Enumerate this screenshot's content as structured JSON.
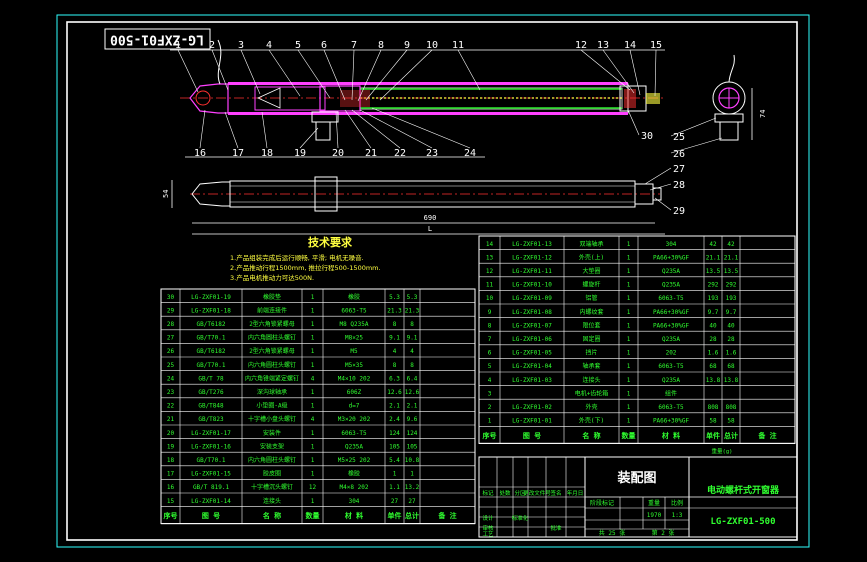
{
  "stamp": "LG-ZXF01-500",
  "balloons_top": [
    "1",
    "2",
    "3",
    "4",
    "5",
    "6",
    "7",
    "8",
    "9",
    "10",
    "11",
    "12",
    "13",
    "14",
    "15"
  ],
  "balloons_bottom": [
    "16",
    "17",
    "18",
    "19",
    "20",
    "21",
    "22",
    "23",
    "24"
  ],
  "balloons_right": [
    "30",
    "25",
    "26",
    "27",
    "28",
    "29"
  ],
  "dims": {
    "overall": "690",
    "length": "L",
    "height_side": "54",
    "height_end": "74"
  },
  "tech_title": "技术要求",
  "tech_notes": [
    "1.产品组装完成后运行顺畅, 平滑; 电机无噪音.",
    "2.产品推动行程1500mm, 推拉行程500-1500mm.",
    "3.产品电机推动力可达500N."
  ],
  "left_table": {
    "rows": [
      [
        "30",
        "LG-ZXF01-19",
        "橡胶垫",
        "1",
        "橡胶",
        "5.3",
        "5.3"
      ],
      [
        "29",
        "LG-ZXF01-18",
        "前端连接件",
        "1",
        "6063-T5",
        "21.3",
        "21.3"
      ],
      [
        "28",
        "GB/T6182",
        "2型六角锁紧螺母",
        "1",
        "M8 Q235A",
        "8",
        "8"
      ],
      [
        "27",
        "GB/T70.1",
        "内六角圆柱头螺钉",
        "1",
        "M8×25",
        "9.1",
        "9.1"
      ],
      [
        "26",
        "GB/T6182",
        "2型六角锁紧螺母",
        "1",
        "M5",
        "4",
        "4"
      ],
      [
        "25",
        "GB/T70.1",
        "内六角圆柱头螺钉",
        "1",
        "M5×35",
        "8",
        "8"
      ],
      [
        "24",
        "GB/T 78",
        "内六角锥端紧定螺钉",
        "4",
        "M4×10 202",
        "6.3",
        "6.4"
      ],
      [
        "23",
        "GB/T276",
        "深沟球轴承",
        "1",
        "606Z",
        "12.6",
        "12.6"
      ],
      [
        "22",
        "GB/T848",
        "小垫圈-A级",
        "1",
        "d=7",
        "2.1",
        "2.1"
      ],
      [
        "21",
        "GB/T823",
        "十字槽小盘头螺钉",
        "4",
        "M3×20 202",
        "2.4",
        "9.6"
      ],
      [
        "20",
        "LG-ZXF01-17",
        "安装件",
        "1",
        "6063-T5",
        "124",
        "124"
      ],
      [
        "19",
        "LG-ZXF01-16",
        "安装支架",
        "1",
        "Q235A",
        "105",
        "105"
      ],
      [
        "18",
        "GB/T70.1",
        "内六角圆柱头螺钉",
        "1",
        "M5×25 202",
        "5.4",
        "10.8"
      ],
      [
        "17",
        "LG-ZXF01-15",
        "胶皮圈",
        "1",
        "橡胶",
        "1",
        "1"
      ],
      [
        "16",
        "GB/T 819.1",
        "十字槽沉头螺钉",
        "12",
        "M4×8 202",
        "1.1",
        "13.2"
      ],
      [
        "15",
        "LG-ZXF01-14",
        "连接头",
        "1",
        "304",
        "27",
        "27"
      ]
    ],
    "header": [
      "序号",
      "图  号",
      "名    称",
      "数量",
      "材    料",
      "单件",
      "总计",
      "备    注"
    ]
  },
  "right_table": {
    "rows": [
      [
        "14",
        "LG-ZXF01-13",
        "双端轴承",
        "1",
        "304",
        "42",
        "42"
      ],
      [
        "13",
        "LG-ZXF01-12",
        "外壳(上)",
        "1",
        "PA66+30%GF",
        "21.1",
        "21.1"
      ],
      [
        "12",
        "LG-ZXF01-11",
        "大垫圈",
        "1",
        "Q235A",
        "13.5",
        "13.5"
      ],
      [
        "11",
        "LG-ZXF01-10",
        "螺旋杆",
        "1",
        "Q235A",
        "292",
        "292"
      ],
      [
        "10",
        "LG-ZXF01-09",
        "铝管",
        "1",
        "6063-T5",
        "193",
        "193"
      ],
      [
        "9",
        "LG-ZXF01-08",
        "内螺纹套",
        "1",
        "PA66+30%GF",
        "9.7",
        "9.7"
      ],
      [
        "8",
        "LG-ZXF01-07",
        "限位套",
        "1",
        "PA66+30%GF",
        "40",
        "40"
      ],
      [
        "7",
        "LG-ZXF01-06",
        "固定圈",
        "1",
        "Q235A",
        "28",
        "28"
      ],
      [
        "6",
        "LG-ZXF01-05",
        "挡片",
        "1",
        "202",
        "1.6",
        "1.6"
      ],
      [
        "5",
        "LG-ZXF01-04",
        "轴承套",
        "1",
        "6063-T5",
        "68",
        "68"
      ],
      [
        "4",
        "LG-ZXF01-03",
        "连接头",
        "1",
        "Q235A",
        "13.8",
        "13.8"
      ],
      [
        "3",
        "",
        "电机+齿轮箱",
        "1",
        "组件",
        "",
        ""
      ],
      [
        "2",
        "LG-ZXF01-02",
        "外壳",
        "1",
        "6063-T5",
        "808",
        "808"
      ],
      [
        "1",
        "LG-ZXF01-01",
        "外壳(下)",
        "1",
        "PA66+30%GF",
        "58",
        "58"
      ]
    ],
    "header": [
      "序号",
      "图    号",
      "名    称",
      "数量",
      "材    料",
      "单件",
      "总计",
      "备    注"
    ],
    "weight_label": "重量(g)"
  },
  "title_block": {
    "drawing_title": "装配图",
    "product_name": "电动螺杆式开窗器",
    "drawing_no": "LG-ZXF01-500",
    "labels": [
      "标记",
      "处数",
      "分区",
      "更改文件号",
      "签名",
      "年月日",
      "设计",
      "标准化",
      "审核",
      "工艺",
      "批准"
    ],
    "stage_labels": [
      "阶段标记",
      "重量",
      "比例"
    ],
    "weight": "1970",
    "scale": "1:3",
    "sheet_total": "共  25  张",
    "sheet_no": "第  2  张"
  },
  "colors": {
    "background": "#000000",
    "frame": "#ffffff",
    "inner_frame": "#30ffff",
    "body_line": "#ffffff",
    "hatch": "#ff40ff",
    "center_line": "#ff3030",
    "table_line": "#ffffff",
    "table_text": "#30ff30",
    "tech_text": "#ffff40"
  }
}
